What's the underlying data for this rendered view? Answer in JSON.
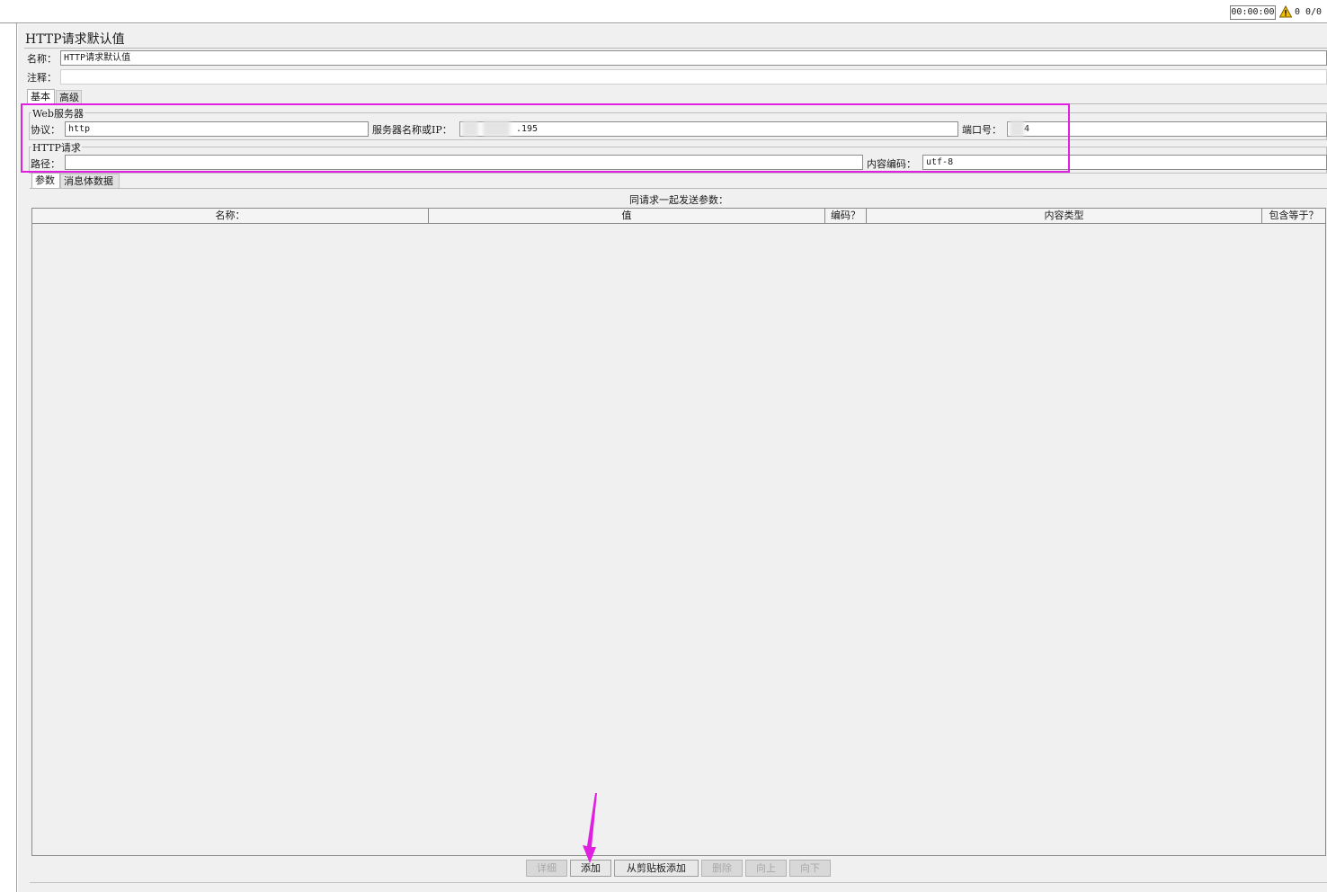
{
  "status_bar": {
    "elapsed_time": "00:00:00",
    "warning_count": "0",
    "thread_count": "0/0"
  },
  "panel": {
    "title": "HTTP请求默认值",
    "name_label": "名称：",
    "name_value": "HTTP请求默认值",
    "comment_label": "注释：",
    "comment_value": ""
  },
  "tabs": {
    "basic": "基本",
    "advanced": "高级"
  },
  "web_server": {
    "group_title": "Web服务器",
    "protocol_label": "协议：",
    "protocol_value": "http",
    "server_label": "服务器名称或IP：",
    "server_value_visible": ".195",
    "port_label": "端口号：",
    "port_value_visible": "4"
  },
  "http_request": {
    "group_title": "HTTP请求",
    "path_label": "路径：",
    "path_value": "",
    "encoding_label": "内容编码：",
    "encoding_value": "utf-8"
  },
  "sub_tabs": {
    "parameters": "参数",
    "body_data": "消息体数据"
  },
  "parameters_table": {
    "caption": "同请求一起发送参数：",
    "columns": [
      "名称：",
      "值",
      "编码？",
      "内容类型",
      "包含等于？"
    ]
  },
  "buttons": {
    "detail": "详细",
    "add": "添加",
    "add_from_clipboard": "从剪贴板添加",
    "delete": "删除",
    "up": "向上",
    "down": "向下"
  },
  "colors": {
    "highlight": "#e020e0",
    "warning": "#f2c200"
  }
}
